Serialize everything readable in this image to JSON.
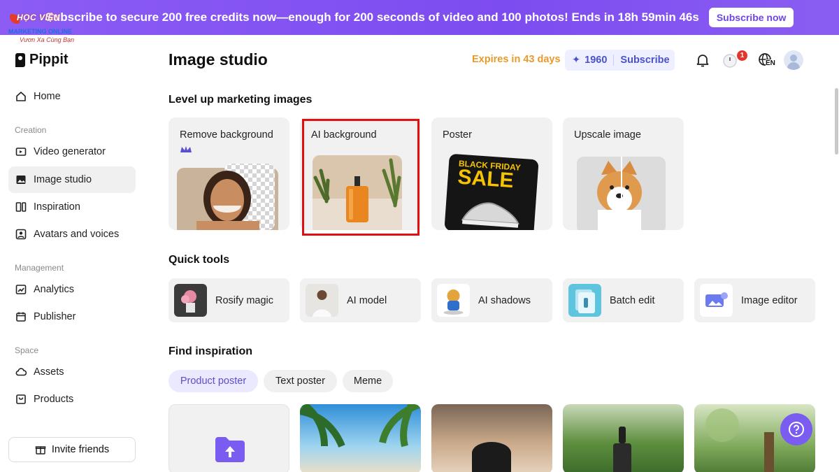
{
  "banner": {
    "text": "Subscribe to secure 200 free credits now—enough for 200 seconds of video and 100 photos! Ends in 18h 59min 46s",
    "button": "Subscribe now"
  },
  "watermark": {
    "line1": "HỌC VIỆN",
    "line2": "MARKETING ONLINE",
    "line3": "Vươn Xa Cùng Bạn"
  },
  "sidebar": {
    "brand": "Pippit",
    "home": "Home",
    "creation_label": "Creation",
    "creation": [
      "Video generator",
      "Image studio",
      "Inspiration",
      "Avatars and voices"
    ],
    "management_label": "Management",
    "management": [
      "Analytics",
      "Publisher"
    ],
    "space_label": "Space",
    "space": [
      "Assets",
      "Products"
    ],
    "invite": "Invite friends"
  },
  "header": {
    "title": "Image studio",
    "expires": "Expires in 43 days",
    "credits": "1960",
    "subscribe": "Subscribe",
    "notification_count": "1",
    "language": "EN"
  },
  "sections": {
    "level_up": "Level up marketing images",
    "quick_tools": "Quick tools",
    "find_inspiration": "Find inspiration"
  },
  "features": [
    "Remove background",
    "AI background",
    "Poster",
    "Upscale image"
  ],
  "poster_art": {
    "line1": "BLACK FRIDAY",
    "line2": "SALE"
  },
  "tools": [
    "Rosify magic",
    "AI model",
    "AI shadows",
    "Batch edit",
    "Image editor"
  ],
  "chips": [
    "Product poster",
    "Text poster",
    "Meme"
  ],
  "colors": {
    "banner": "#8c5cf5",
    "accent": "#4a52c9",
    "expires": "#e99a2a",
    "highlight": "#e01010",
    "help": "#7b5cf0"
  }
}
